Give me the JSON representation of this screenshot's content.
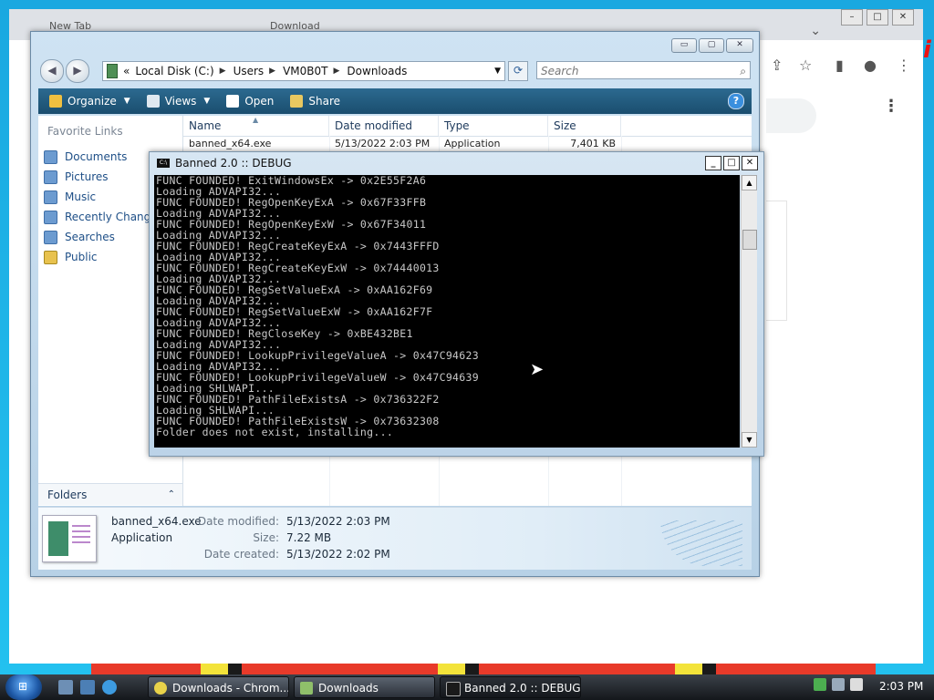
{
  "chrome": {
    "tab_labels": [
      "New Tab",
      "Download"
    ],
    "caption_minimize": "–",
    "caption_maximize": "□",
    "caption_close": "✕",
    "tab_chevron": "⌄"
  },
  "explorer": {
    "caption": {
      "minimize": "▭",
      "maximize": "▢",
      "close": "✕"
    },
    "nav": {
      "back": "◀",
      "forward": "▶"
    },
    "address": {
      "leader": "«",
      "segments": [
        "Local Disk (C:)",
        "Users",
        "VM0B0T",
        "Downloads"
      ],
      "separator": "▶",
      "dropdown": "▼"
    },
    "refresh": "⟳",
    "search": {
      "placeholder": "Search",
      "icon": "⌕"
    },
    "commands": [
      {
        "label": "Organize",
        "icon": "organize-icon",
        "color": "#f0c040",
        "has_caret": true
      },
      {
        "label": "Views",
        "icon": "views-icon",
        "color": "#dfe8f0",
        "has_caret": true
      },
      {
        "label": "Open",
        "icon": "open-icon",
        "color": "#ffffff",
        "has_caret": false
      },
      {
        "label": "Share",
        "icon": "share-icon",
        "color": "#e8c860",
        "has_caret": false
      }
    ],
    "help": "?",
    "favorites_title": "Favorite Links",
    "favorites": [
      "Documents",
      "Pictures",
      "Music",
      "Recently Change",
      "Searches",
      "Public"
    ],
    "folders_label": "Folders",
    "folders_toggle": "⌃",
    "columns": [
      "Name",
      "Date modified",
      "Type",
      "Size"
    ],
    "file_row": {
      "name": "banned_x64.exe",
      "date": "5/13/2022 2:03 PM",
      "type": "Application",
      "size": "7,401 KB"
    },
    "details": {
      "name": "banned_x64.exe",
      "type": "Application",
      "modified_label": "Date modified:",
      "modified": "5/13/2022 2:03 PM",
      "size_label": "Size:",
      "size": "7.22 MB",
      "created_label": "Date created:",
      "created": "5/13/2022 2:02 PM"
    }
  },
  "console": {
    "title": "Banned 2.0 :: DEBUG",
    "icon_text": "C:\\",
    "buttons": {
      "minimize": "_",
      "maximize": "□",
      "close": "✕"
    },
    "lines": [
      "FUNC FOUNDED! ExitWindowsEx -> 0x2E55F2A6",
      "Loading ADVAPI32...",
      "FUNC FOUNDED! RegOpenKeyExA -> 0x67F33FFB",
      "Loading ADVAPI32...",
      "FUNC FOUNDED! RegOpenKeyExW -> 0x67F34011",
      "Loading ADVAPI32...",
      "FUNC FOUNDED! RegCreateKeyExA -> 0x7443FFFD",
      "Loading ADVAPI32...",
      "FUNC FOUNDED! RegCreateKeyExW -> 0x74440013",
      "Loading ADVAPI32...",
      "FUNC FOUNDED! RegSetValueExA -> 0xAA162F69",
      "Loading ADVAPI32...",
      "FUNC FOUNDED! RegSetValueExW -> 0xAA162F7F",
      "Loading ADVAPI32...",
      "FUNC FOUNDED! RegCloseKey -> 0xBE432BE1",
      "Loading ADVAPI32...",
      "FUNC FOUNDED! LookupPrivilegeValueA -> 0x47C94623",
      "Loading ADVAPI32...",
      "FUNC FOUNDED! LookupPrivilegeValueW -> 0x47C94639",
      "Loading SHLWAPI...",
      "FUNC FOUNDED! PathFileExistsA -> 0x736322F2",
      "Loading SHLWAPI...",
      "FUNC FOUNDED! PathFileExistsW -> 0x73632308",
      "Folder does not exist, installing..."
    ],
    "scroll_up": "▲",
    "scroll_down": "▼"
  },
  "taskbar": {
    "buttons": [
      {
        "label": "Downloads - Chrom...",
        "icon": "chrome-icon",
        "color": "#e8d24a"
      },
      {
        "label": "Downloads",
        "icon": "folder-icon",
        "color": "#8fbf6a"
      },
      {
        "label": "Banned 2.0 :: DEBUG",
        "icon": "console-icon",
        "color": "#1a1a1a"
      }
    ],
    "start_glyph": "⊞",
    "clock": "2:03 PM"
  }
}
